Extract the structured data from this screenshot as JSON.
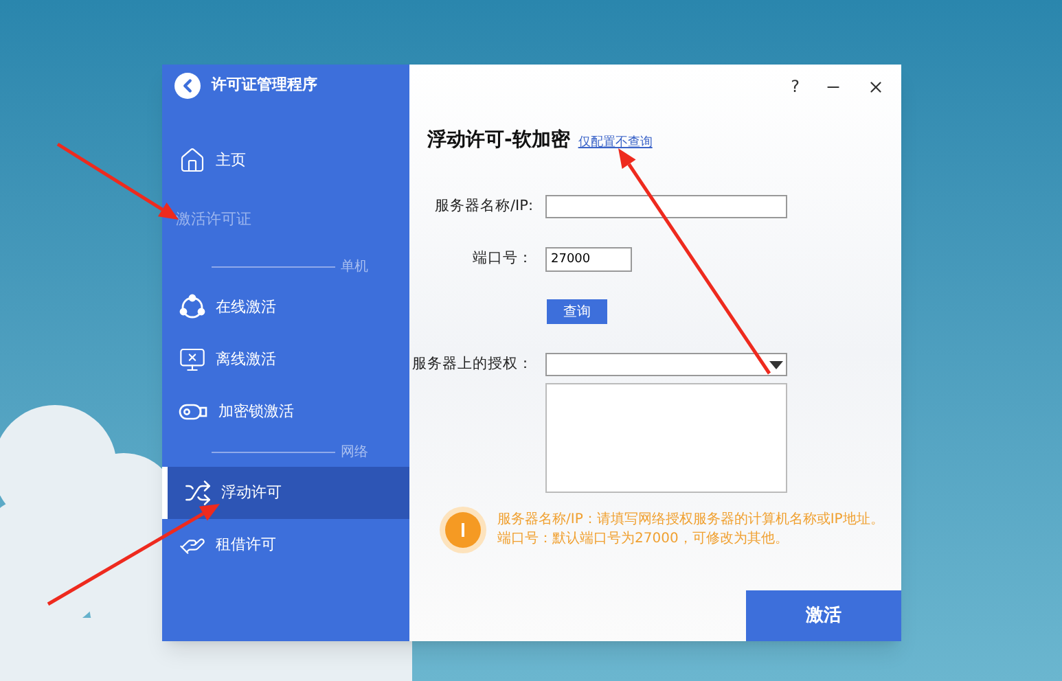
{
  "window": {
    "title": "许可证管理程序",
    "help": "?"
  },
  "sidebar": {
    "items": [
      {
        "kind": "nav",
        "label": "主页",
        "selected": false
      },
      {
        "kind": "heading",
        "label": "激活许可证"
      },
      {
        "kind": "divider",
        "label": "单机"
      },
      {
        "kind": "nav",
        "label": "在线激活",
        "selected": false
      },
      {
        "kind": "nav",
        "label": "离线激活",
        "selected": false
      },
      {
        "kind": "nav",
        "label": "加密锁激活",
        "selected": false
      },
      {
        "kind": "divider",
        "label": "网络"
      },
      {
        "kind": "nav",
        "label": "浮动许可",
        "selected": true
      },
      {
        "kind": "nav",
        "label": "租借许可",
        "selected": false
      }
    ]
  },
  "page": {
    "title": "浮动许可-软加密",
    "link": "仅配置不查询",
    "server": {
      "label": "服务器名称/IP:"
    },
    "port": {
      "label": "端口号：",
      "value": "27000"
    },
    "query_button": "查询",
    "license": {
      "label": "服务器上的授权："
    },
    "notes": [
      "服务器名称/IP：请填写网络授权服务器的计算机名称或IP地址。",
      "端口号：默认端口号为27000，可修改为其他。"
    ],
    "activate_button": "激活"
  }
}
